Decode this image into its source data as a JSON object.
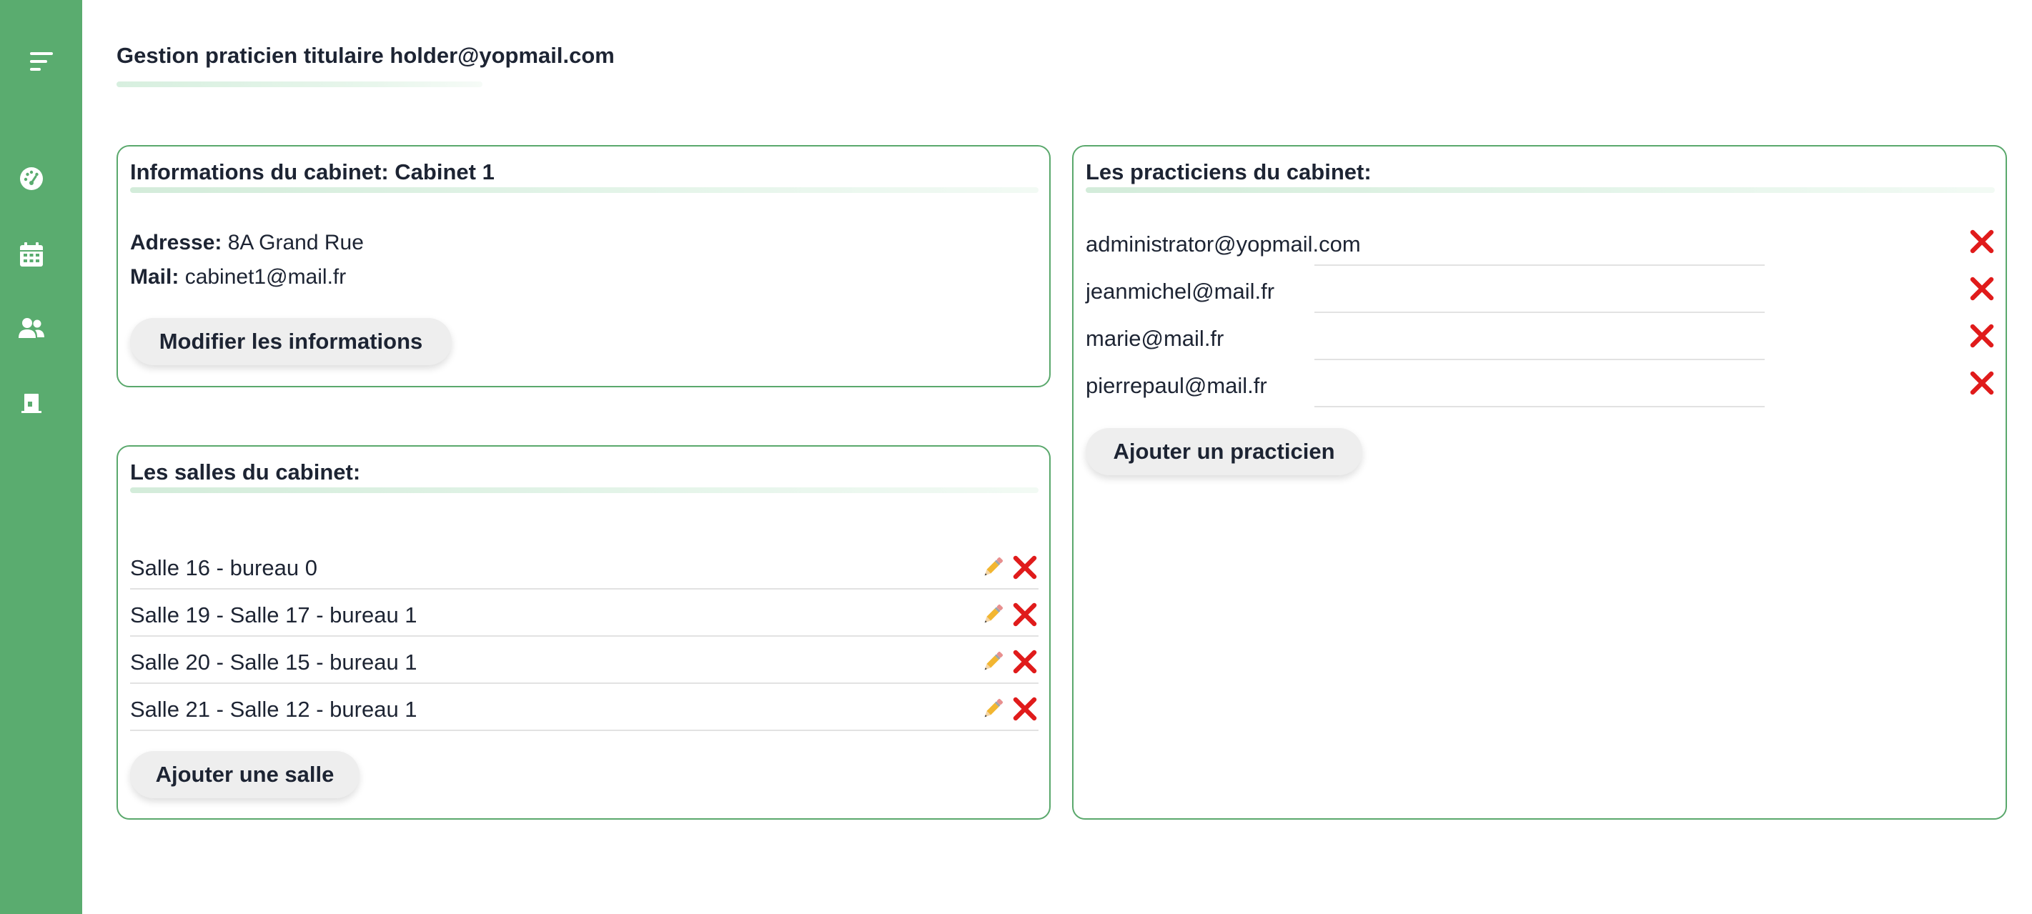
{
  "theme": {
    "sidebar": "#5aac6f",
    "accent": "#5aa86c",
    "delete": "#e01b1b"
  },
  "sidebar": {
    "icons": [
      "menu-icon",
      "gauge-icon",
      "calendar-icon",
      "users-icon",
      "door-icon"
    ]
  },
  "page": {
    "title": "Gestion praticien titulaire holder@yopmail.com"
  },
  "info_card": {
    "title": "Informations du cabinet: Cabinet 1",
    "address_label": "Adresse:",
    "address_value": "8A Grand Rue",
    "mail_label": "Mail:",
    "mail_value": "cabinet1@mail.fr",
    "modify_button": "Modifier les informations"
  },
  "rooms_card": {
    "title": "Les salles du cabinet:",
    "rooms": [
      "Salle 16 - bureau 0",
      "Salle 19 - Salle 17 - bureau 1",
      "Salle 20 - Salle 15 - bureau 1",
      "Salle 21 - Salle 12 - bureau 1"
    ],
    "add_button": "Ajouter une salle"
  },
  "practitioners_card": {
    "title": "Les practiciens du cabinet:",
    "practitioners": [
      "administrator@yopmail.com",
      "jeanmichel@mail.fr",
      "marie@mail.fr",
      "pierrepaul@mail.fr"
    ],
    "add_button": "Ajouter un practicien"
  }
}
